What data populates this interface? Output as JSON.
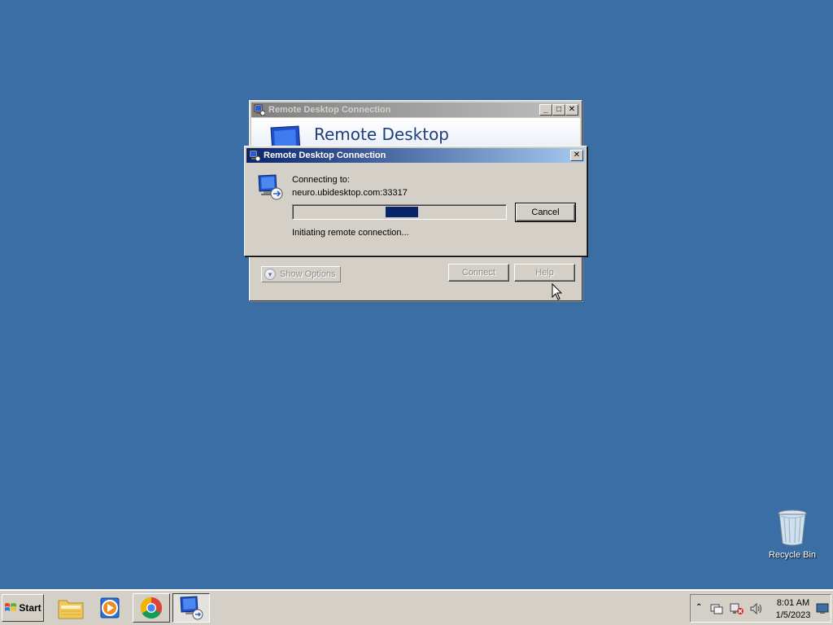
{
  "desktop": {
    "recycle_bin_label": "Recycle Bin",
    "background_color": "#3a6ea5"
  },
  "background_window": {
    "title": "Remote Desktop Connection",
    "banner_title": "Remote Desktop",
    "show_options_label": "Show Options",
    "connect_label": "Connect",
    "help_label": "Help"
  },
  "dialog": {
    "title": "Remote Desktop Connection",
    "connecting_label": "Connecting to:",
    "host": "neuro.ubidesktop.com:33317",
    "status": "Initiating remote connection...",
    "cancel_label": "Cancel"
  },
  "taskbar": {
    "start_label": "Start",
    "items": [
      "file-explorer-icon",
      "media-player-icon",
      "chrome-icon",
      "remote-desktop-icon"
    ],
    "clock_time": "8:01 AM",
    "clock_date": "1/5/2023"
  },
  "colors": {
    "active_title_start": "#0a246a",
    "active_title_end": "#a6caf0",
    "face": "#d4d0c8"
  }
}
